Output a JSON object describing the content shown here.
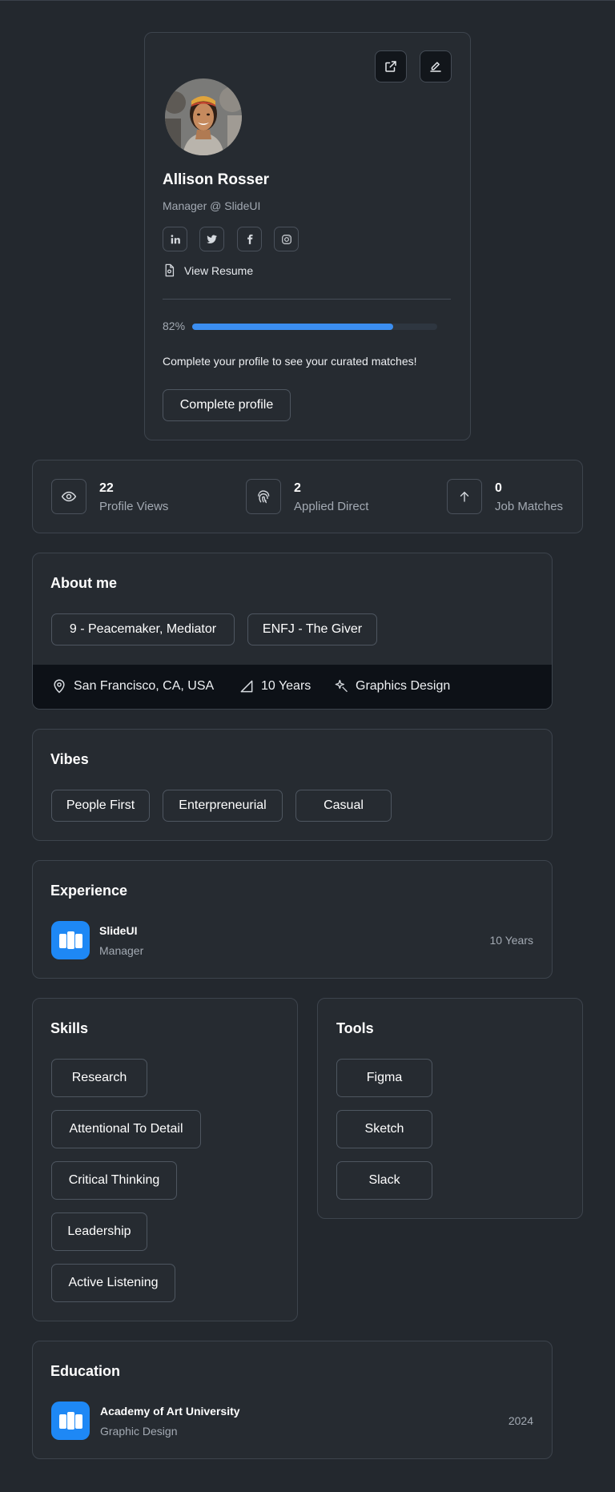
{
  "profile": {
    "name": "Allison Rosser",
    "role": "Manager @ SlideUI",
    "resume_label": "View Resume",
    "progress_text": "82%",
    "progress_fraction": 0.82,
    "message": "Complete your profile to see your curated matches!",
    "cta_label": "Complete profile",
    "socials": [
      "linkedin-icon",
      "twitter-icon",
      "facebook-icon",
      "instagram-icon"
    ]
  },
  "stats": [
    {
      "value": "22",
      "label": "Profile Views",
      "icon": "eye-icon"
    },
    {
      "value": "2",
      "label": "Applied Direct",
      "icon": "fingerprint-icon"
    },
    {
      "value": "0",
      "label": "Job Matches",
      "icon": "arrow-up-icon"
    }
  ],
  "about": {
    "title": "About me",
    "tags": [
      "9 - Peacemaker, Mediator",
      "ENFJ - The Giver"
    ],
    "location": "San Francisco, CA, USA",
    "experience": "10 Years",
    "field": "Graphics Design"
  },
  "vibes": {
    "title": "Vibes",
    "tags": [
      "People First",
      "Enterpreneurial",
      "Casual"
    ]
  },
  "experience": {
    "title": "Experience",
    "company": "SlideUI",
    "role": "Manager",
    "duration": "10 Years"
  },
  "skills": {
    "title": "Skills",
    "items": [
      "Research",
      "Attentional To Detail",
      "Critical Thinking",
      "Leadership",
      "Active Listening"
    ]
  },
  "tools": {
    "title": "Tools",
    "items": [
      "Figma",
      "Sketch",
      "Slack"
    ]
  },
  "education": {
    "title": "Education",
    "school": "Academy of Art University",
    "program": "Graphic Design",
    "year": "2024"
  },
  "colors": {
    "background": "#23282e",
    "card": "#262b31",
    "accent": "#3b8ef1",
    "logo": "#1e88f5"
  }
}
